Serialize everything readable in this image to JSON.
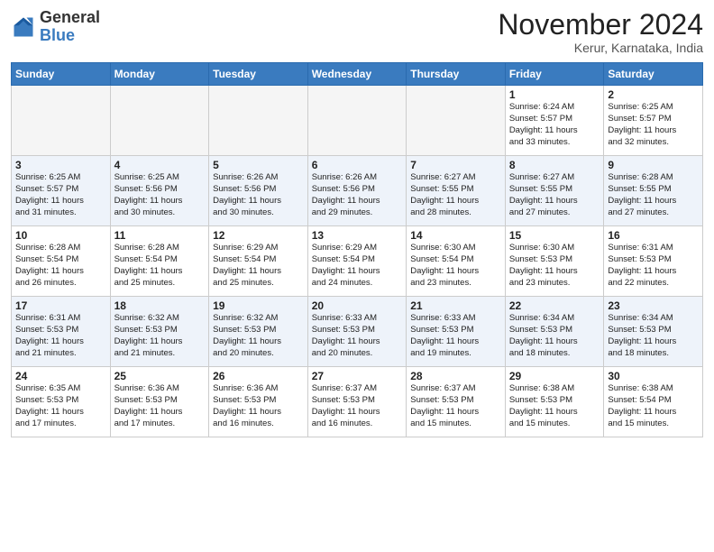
{
  "header": {
    "logo_general": "General",
    "logo_blue": "Blue",
    "month_title": "November 2024",
    "location": "Kerur, Karnataka, India"
  },
  "weekdays": [
    "Sunday",
    "Monday",
    "Tuesday",
    "Wednesday",
    "Thursday",
    "Friday",
    "Saturday"
  ],
  "weeks": [
    [
      {
        "day": "",
        "info": ""
      },
      {
        "day": "",
        "info": ""
      },
      {
        "day": "",
        "info": ""
      },
      {
        "day": "",
        "info": ""
      },
      {
        "day": "",
        "info": ""
      },
      {
        "day": "1",
        "info": "Sunrise: 6:24 AM\nSunset: 5:57 PM\nDaylight: 11 hours\nand 33 minutes."
      },
      {
        "day": "2",
        "info": "Sunrise: 6:25 AM\nSunset: 5:57 PM\nDaylight: 11 hours\nand 32 minutes."
      }
    ],
    [
      {
        "day": "3",
        "info": "Sunrise: 6:25 AM\nSunset: 5:57 PM\nDaylight: 11 hours\nand 31 minutes."
      },
      {
        "day": "4",
        "info": "Sunrise: 6:25 AM\nSunset: 5:56 PM\nDaylight: 11 hours\nand 30 minutes."
      },
      {
        "day": "5",
        "info": "Sunrise: 6:26 AM\nSunset: 5:56 PM\nDaylight: 11 hours\nand 30 minutes."
      },
      {
        "day": "6",
        "info": "Sunrise: 6:26 AM\nSunset: 5:56 PM\nDaylight: 11 hours\nand 29 minutes."
      },
      {
        "day": "7",
        "info": "Sunrise: 6:27 AM\nSunset: 5:55 PM\nDaylight: 11 hours\nand 28 minutes."
      },
      {
        "day": "8",
        "info": "Sunrise: 6:27 AM\nSunset: 5:55 PM\nDaylight: 11 hours\nand 27 minutes."
      },
      {
        "day": "9",
        "info": "Sunrise: 6:28 AM\nSunset: 5:55 PM\nDaylight: 11 hours\nand 27 minutes."
      }
    ],
    [
      {
        "day": "10",
        "info": "Sunrise: 6:28 AM\nSunset: 5:54 PM\nDaylight: 11 hours\nand 26 minutes."
      },
      {
        "day": "11",
        "info": "Sunrise: 6:28 AM\nSunset: 5:54 PM\nDaylight: 11 hours\nand 25 minutes."
      },
      {
        "day": "12",
        "info": "Sunrise: 6:29 AM\nSunset: 5:54 PM\nDaylight: 11 hours\nand 25 minutes."
      },
      {
        "day": "13",
        "info": "Sunrise: 6:29 AM\nSunset: 5:54 PM\nDaylight: 11 hours\nand 24 minutes."
      },
      {
        "day": "14",
        "info": "Sunrise: 6:30 AM\nSunset: 5:54 PM\nDaylight: 11 hours\nand 23 minutes."
      },
      {
        "day": "15",
        "info": "Sunrise: 6:30 AM\nSunset: 5:53 PM\nDaylight: 11 hours\nand 23 minutes."
      },
      {
        "day": "16",
        "info": "Sunrise: 6:31 AM\nSunset: 5:53 PM\nDaylight: 11 hours\nand 22 minutes."
      }
    ],
    [
      {
        "day": "17",
        "info": "Sunrise: 6:31 AM\nSunset: 5:53 PM\nDaylight: 11 hours\nand 21 minutes."
      },
      {
        "day": "18",
        "info": "Sunrise: 6:32 AM\nSunset: 5:53 PM\nDaylight: 11 hours\nand 21 minutes."
      },
      {
        "day": "19",
        "info": "Sunrise: 6:32 AM\nSunset: 5:53 PM\nDaylight: 11 hours\nand 20 minutes."
      },
      {
        "day": "20",
        "info": "Sunrise: 6:33 AM\nSunset: 5:53 PM\nDaylight: 11 hours\nand 20 minutes."
      },
      {
        "day": "21",
        "info": "Sunrise: 6:33 AM\nSunset: 5:53 PM\nDaylight: 11 hours\nand 19 minutes."
      },
      {
        "day": "22",
        "info": "Sunrise: 6:34 AM\nSunset: 5:53 PM\nDaylight: 11 hours\nand 18 minutes."
      },
      {
        "day": "23",
        "info": "Sunrise: 6:34 AM\nSunset: 5:53 PM\nDaylight: 11 hours\nand 18 minutes."
      }
    ],
    [
      {
        "day": "24",
        "info": "Sunrise: 6:35 AM\nSunset: 5:53 PM\nDaylight: 11 hours\nand 17 minutes."
      },
      {
        "day": "25",
        "info": "Sunrise: 6:36 AM\nSunset: 5:53 PM\nDaylight: 11 hours\nand 17 minutes."
      },
      {
        "day": "26",
        "info": "Sunrise: 6:36 AM\nSunset: 5:53 PM\nDaylight: 11 hours\nand 16 minutes."
      },
      {
        "day": "27",
        "info": "Sunrise: 6:37 AM\nSunset: 5:53 PM\nDaylight: 11 hours\nand 16 minutes."
      },
      {
        "day": "28",
        "info": "Sunrise: 6:37 AM\nSunset: 5:53 PM\nDaylight: 11 hours\nand 15 minutes."
      },
      {
        "day": "29",
        "info": "Sunrise: 6:38 AM\nSunset: 5:53 PM\nDaylight: 11 hours\nand 15 minutes."
      },
      {
        "day": "30",
        "info": "Sunrise: 6:38 AM\nSunset: 5:54 PM\nDaylight: 11 hours\nand 15 minutes."
      }
    ]
  ]
}
